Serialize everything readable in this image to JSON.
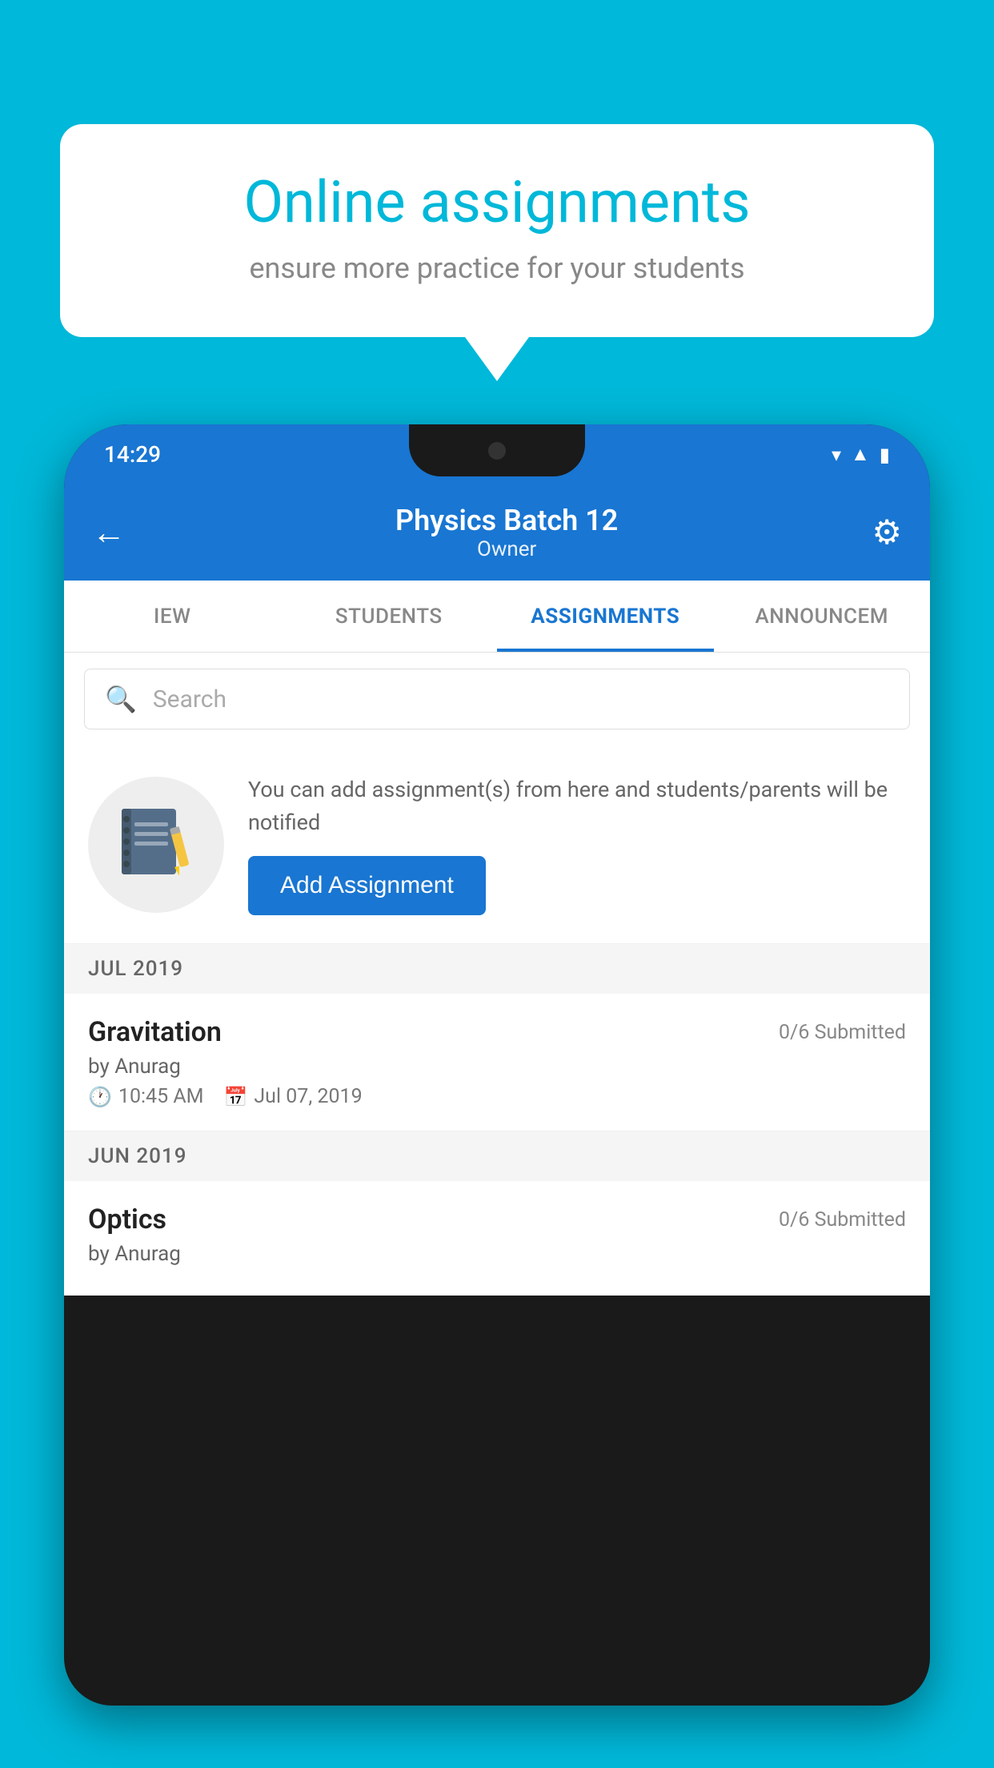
{
  "background": {
    "color": "#00B8D9"
  },
  "speech_bubble": {
    "title": "Online assignments",
    "subtitle": "ensure more practice for your students"
  },
  "phone": {
    "status_bar": {
      "time": "14:29",
      "icons": [
        "wifi",
        "signal",
        "battery"
      ]
    },
    "app_bar": {
      "title": "Physics Batch 12",
      "subtitle": "Owner",
      "back_label": "←",
      "settings_label": "⚙"
    },
    "tabs": [
      {
        "label": "IEW",
        "active": false
      },
      {
        "label": "STUDENTS",
        "active": false
      },
      {
        "label": "ASSIGNMENTS",
        "active": true
      },
      {
        "label": "ANNOUNCEM",
        "active": false
      }
    ],
    "search": {
      "placeholder": "Search",
      "icon": "🔍"
    },
    "promo": {
      "text": "You can add assignment(s) from here and students/parents will be notified",
      "button_label": "Add Assignment"
    },
    "sections": [
      {
        "month": "JUL 2019",
        "assignments": [
          {
            "name": "Gravitation",
            "submitted": "0/6 Submitted",
            "by": "by Anurag",
            "time": "10:45 AM",
            "date": "Jul 07, 2019"
          }
        ]
      },
      {
        "month": "JUN 2019",
        "assignments": [
          {
            "name": "Optics",
            "submitted": "0/6 Submitted",
            "by": "by Anurag",
            "time": "",
            "date": ""
          }
        ]
      }
    ]
  }
}
